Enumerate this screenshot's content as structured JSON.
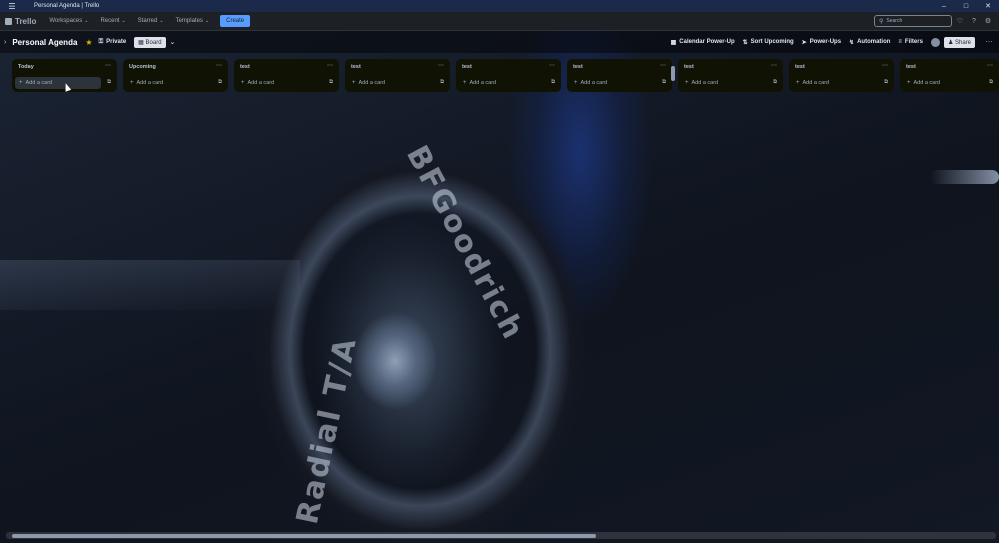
{
  "window": {
    "title": "Personal Agenda | Trello",
    "controls": [
      "minimize",
      "maximize",
      "close"
    ]
  },
  "header": {
    "logo": "Trello",
    "nav": [
      {
        "label": "Workspaces"
      },
      {
        "label": "Recent"
      },
      {
        "label": "Starred"
      },
      {
        "label": "Templates"
      }
    ],
    "create_label": "Create",
    "search_placeholder": "Search",
    "icons": [
      "bell-icon",
      "help-icon",
      "gear-icon"
    ]
  },
  "board": {
    "name": "Personal Agenda",
    "visibility": "Private",
    "view": "Board",
    "actions": {
      "calendar": "Calendar Power-Up",
      "sort": "Sort Upcoming",
      "powerups": "Power-Ups",
      "automation": "Automation",
      "filters": "Filters",
      "share": "Share"
    }
  },
  "lists": [
    {
      "title": "Today",
      "add_card": "Add a card"
    },
    {
      "title": "Upcoming",
      "add_card": "Add a card"
    },
    {
      "title": "test",
      "add_card": "Add a card"
    },
    {
      "title": "test",
      "add_card": "Add a card"
    },
    {
      "title": "test",
      "add_card": "Add a card"
    },
    {
      "title": "test",
      "add_card": "Add a card"
    },
    {
      "title": "test",
      "add_card": "Add a card"
    },
    {
      "title": "test",
      "add_card": "Add a card"
    },
    {
      "title": "test",
      "add_card": "Add a card"
    }
  ],
  "tire": {
    "brand": "BFGoodrich",
    "model": "Radial T/A"
  },
  "colors": {
    "titlebar": "#1b2a4a",
    "header": "#1d2125",
    "list_bg": "#101204",
    "create_button": "#579dff",
    "star": "#e2b203"
  }
}
